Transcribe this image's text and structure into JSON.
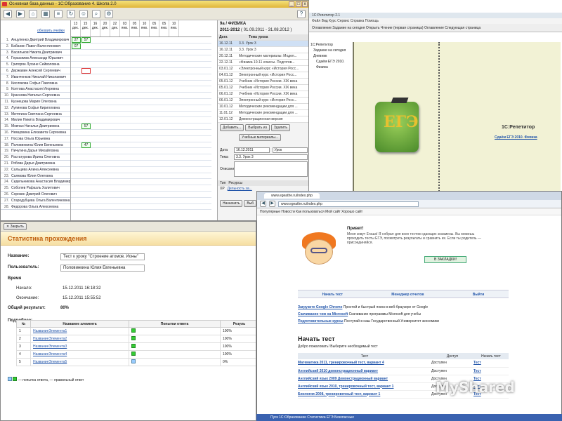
{
  "journal": {
    "title": "1С:Образование 4. Школа 2.0",
    "title_prefix": "Основная база данных - ",
    "update_link": "обновить ячейки",
    "dates": [
      "13 дек.",
      "15 дек.",
      "16 дек.",
      "20 дек.",
      "22 дек.",
      "03 янв.",
      "05 янв.",
      "10 янв.",
      "05 янв.",
      "05 янв.",
      "10 янв."
    ],
    "students": [
      "Анцупенко Дмитрий Владимирович",
      "Бабанин Павел Валентинович",
      "Васильков Никита Дмитриевич",
      "Герасимов Александр Юрьевич",
      "Григорян Лусине Сейволовна",
      "Державин Алексей Сергеевич",
      "Иванченков Николай Николаевич",
      "Кислякова Софья Павловна",
      "Колтова Анастасия Игоревна",
      "Краснова Наталья Сергеевна",
      "Кузнецова Мария Олеговна",
      "Лупинова Софья Кирилловна",
      "Митягина Светлана Сергеевна",
      "Милин Никита Владимирович",
      "Мовчан Наталья Дмитриевна",
      "Немцовина Елизавета Сергеевна",
      "Носова Ольга Юрьевна",
      "Половинкина Юлия Евгеньевна",
      "Пичугина Дарья Михайловна",
      "Растатурова Ирина Олеговна",
      "Рябова Дарья Дмитриевна",
      "Сальцева Алина Алексеевна",
      "Салмова Юлия Олеговна",
      "Сидельникова Анастасия Владимировна",
      "Соболев Рафаэль Халитович",
      "Сорокин Дмитрий Олегович",
      "Стародубцева Ольга Валентиновна",
      "Федорова Ольга Алексеевна"
    ],
    "grades": {
      "r0a": "27",
      "r0b": "57",
      "r1a": "07",
      "r14": "57",
      "r17": "47"
    },
    "panel": {
      "class_label": "9а / ФИЗИКА",
      "year": "2011-2012",
      "year_range": "( 01.09.2011 - 31.08.2012 )",
      "col_date": "Дата",
      "col_topic": "Тема урока",
      "lessons": [
        [
          "16.12.11",
          "3.3. Урок 3"
        ],
        [
          "16.12.11",
          "3.3. Урок 3"
        ],
        [
          "20.12.11",
          "Методические материалы: Модел..."
        ],
        [
          "22.12.11",
          "«Физика 10-11 классы. Подготов..."
        ],
        [
          "03.01.12",
          "«Электронный курс «История Росс..."
        ],
        [
          "04.01.12",
          "Электронный курс «История Росс..."
        ],
        [
          "05.01.12",
          "Учебник «История России. XIX века"
        ],
        [
          "05.01.12",
          "Учебник «История России. XIX века"
        ],
        [
          "06.01.12",
          "Учебник «История России. XIX века"
        ],
        [
          "06.01.12",
          "Электронный курс «История Росс..."
        ],
        [
          "10.01.12",
          "Методические рекомендации для ..."
        ],
        [
          "11.01.12",
          "Методические рекомендации для ..."
        ],
        [
          "12.01.12",
          "Демонстрационная версия"
        ]
      ],
      "btn_add": "Добавить...",
      "btn_choose": "Выбрать из",
      "btn_delete": "Удалить",
      "btn_materials": "Учебные материалы...",
      "date_label": "Дата",
      "date_value": "16.12.2011",
      "type_value": "Урок",
      "topic_label": "Тема",
      "topic_value": "3.3. Урок 3",
      "desc_label": "Описание",
      "col_type": "Тип",
      "col_resources": "Ресурсы",
      "res_kind": "XP",
      "res_name": "Дельность за...",
      "btn_assign": "Назначить",
      "btn_more": "Выб"
    }
  },
  "stats": {
    "toolbar_close": "Закрыть",
    "title": "Статистика прохождения",
    "name_label": "Название:",
    "name_value": "Тест к уроку \"Строение атомов. Ионы\"",
    "user_label": "Пользователь:",
    "user_value": "Половинкина Юлия Евгеньевна",
    "time_label": "Время",
    "start_label": "Начало:",
    "start_value": "15.12.2011 16:18:32",
    "end_label": "Окончание:",
    "end_value": "15.12.2011 15:55:52",
    "result_label": "Общий результат:",
    "result_value": "80%",
    "details_label": "Подробнее:",
    "col_num": "№",
    "col_name": "Название элемента",
    "col_attempts": "Попытки ответа",
    "col_result": "Резуль",
    "rows": [
      {
        "n": "1",
        "name": "НазваниеЭлемента1",
        "res": "100%"
      },
      {
        "n": "2",
        "name": "НазваниеЭлемента2",
        "res": "100%"
      },
      {
        "n": "3",
        "name": "НазваниеЭлемента3",
        "res": "100%"
      },
      {
        "n": "4",
        "name": "НазваниеЭлемента4",
        "res": "100%"
      },
      {
        "n": "5",
        "name": "НазваниеЭлемента5",
        "res": "0%"
      }
    ],
    "legend": "— попытка ответа, — правильный ответ"
  },
  "tutor": {
    "title": "1С:Репетитор 2.1",
    "menu": "Файл  Вид  Курс  Сервис  Справка  Помощь",
    "toolbar": "Оглавление   Задание на сегодня   Открыть   Чтение (первая страница)   Оглавление   Следующая страница",
    "tree": [
      "1С:Репетитор",
      "Задание на сегодня",
      "Дневник",
      "Сдаём ЕГЭ 2010. Физика"
    ],
    "logo": "ЕГЭ",
    "heading": "1С:Репетитор",
    "course": "Сдаём ЕГЭ 2010. Физика"
  },
  "browser": {
    "tab": "www.egeathe.ru/index.php",
    "url": "www.egeathe.ru/index.php",
    "bookmarks": "Популярные   Новости   Как пользоваться   Мой сайт   Хорошо сайт",
    "greeting": "Привет!",
    "intro": "Меня зовут Егэша! Я собрал для всех тестов сдающих экзамены. Вы можешь проходить тесты ЕГЭ, посмотреть результаты и сравнить их. Если ты родитель — присоединяйся.",
    "bookmark_btn": "В ЗАКЛАДКИ!",
    "nav": [
      "Начать тест",
      "Менеджер отчетов",
      "Выйти"
    ],
    "links": [
      {
        "a": "Загрузите Google Chrome",
        "t": "Простой и быстрый поиск в веб-браузере от Google"
      },
      {
        "a": "Скачивание чем на Microsoft",
        "t": "Скачивание программы Microsoft для учебы"
      },
      {
        "a": "Подготовительные курсы",
        "t": "Поступай в наш Государственный Университет экономики"
      }
    ],
    "start_title": "Начать тест",
    "start_desc": "Добро пожаловать! Выберите необходимый тест",
    "th_test": "Тест",
    "th_access": "Доступ",
    "th_open": "Начать тест",
    "tests": [
      {
        "name": "Математика 2011, тренировочный тест, вариант 4",
        "acc": "Доступен",
        "go": "Тест"
      },
      {
        "name": "Английский 2010 демонстрационный вариант",
        "acc": "Доступен",
        "go": "Тест"
      },
      {
        "name": "Английский язык 2009 Демонстрационный вариант",
        "acc": "Доступен",
        "go": "Тест"
      },
      {
        "name": "Английский язык 2010, тренировочный тест, вариант 1",
        "acc": "Доступен",
        "go": "Тест"
      },
      {
        "name": "Биология 2008, тренировочный тест, вариант 1",
        "acc": "Доступен",
        "go": "Тест"
      }
    ]
  },
  "taskbar": "Пуск   1С:Образование   Статистика   ЕГЭ   Безопасные",
  "watermark": "MyShared"
}
